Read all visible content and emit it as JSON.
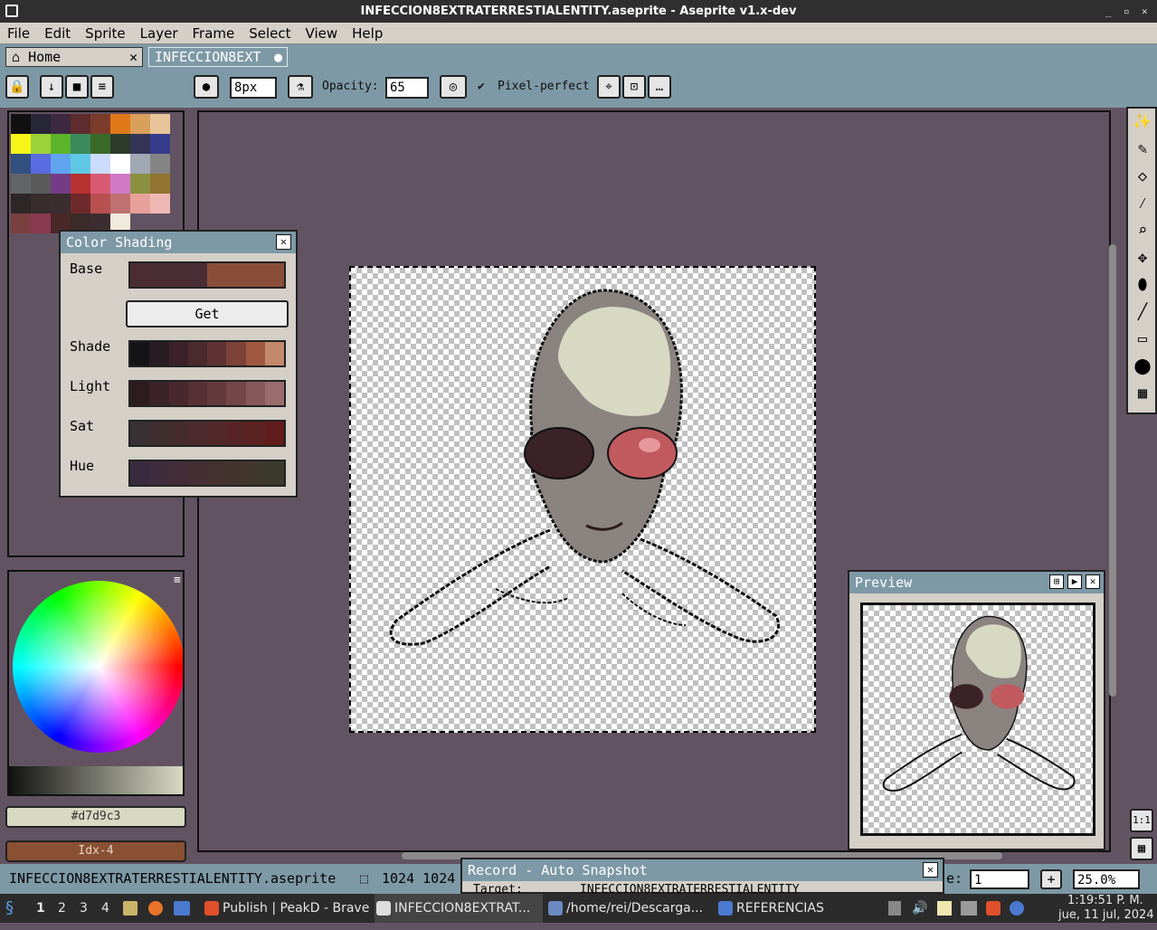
{
  "window": {
    "title": "INFECCION8EXTRATERRESTIALENTITY.aseprite - Aseprite v1.x-dev",
    "controls": [
      "_",
      "▫",
      "✕"
    ]
  },
  "menu": [
    "File",
    "Edit",
    "Sprite",
    "Layer",
    "Frame",
    "Select",
    "View",
    "Help"
  ],
  "tabs": {
    "home": "Home",
    "home_close": "✕",
    "doc": "INFECCION8EXT",
    "doc_dot": "●"
  },
  "toolbar": {
    "brush_size": "8px",
    "opacity_label": "Opacity:",
    "opacity_value": "65",
    "pixel_perfect_label": "Pixel-perfect",
    "pixel_perfect_check": "✔"
  },
  "palette": {
    "colors": [
      "#111111",
      "#262637",
      "#3e2841",
      "#5e2c2c",
      "#7b3c2c",
      "#e0781a",
      "#d8a05a",
      "#e8c49a",
      "#f5f51a",
      "#9cd23a",
      "#5cb42a",
      "#3a8a5c",
      "#3a6a2a",
      "#2c3a2c",
      "#343456",
      "#363c8c",
      "#325080",
      "#5a6ae0",
      "#60a4f0",
      "#60c8e4",
      "#ccdcfc",
      "#ffffff",
      "#a0a8b4",
      "#848484",
      "#626468",
      "#5a5a5a",
      "#743c86",
      "#b83232",
      "#d85a72",
      "#d07ac4",
      "#8a9040",
      "#907430",
      "#2e2626",
      "#382c2c",
      "#3a2e30",
      "#6e2a2a",
      "#b85050",
      "#c07070",
      "#e8a09a",
      "#f0b8b4",
      "#7a4040",
      "#8a3a52",
      "#4a2828",
      "#3a2a2a",
      "#3c2e30",
      "#f0eadc",
      "#625362",
      "#625362"
    ]
  },
  "shading": {
    "title": "Color Shading",
    "close": "✕",
    "base_label": "Base",
    "get_label": "Get",
    "shade_label": "Shade",
    "light_label": "Light",
    "sat_label": "Sat",
    "hue_label": "Hue",
    "base": [
      "#4a2c34",
      "#8a4e38"
    ],
    "shade": [
      "#141418",
      "#281c22",
      "#3a2228",
      "#4a2a2c",
      "#5e3232",
      "#7c4238",
      "#a0583e",
      "#c4886a"
    ],
    "light": [
      "#2c1c20",
      "#3a2228",
      "#48282e",
      "#563034",
      "#643a3c",
      "#744648",
      "#86585a",
      "#9a6c6c"
    ],
    "sat": [
      "#383032",
      "#3e2e30",
      "#442c2e",
      "#4a2a2c",
      "#502828",
      "#562424",
      "#5c2222",
      "#621c1c"
    ],
    "hue": [
      "#3a2a40",
      "#3e2c3c",
      "#422c38",
      "#442e34",
      "#44302e",
      "#42342c",
      "#40382c",
      "#3c3a2c"
    ]
  },
  "colors": {
    "fg_hex": "#d7d9c3",
    "fg": "#d7d9c3",
    "bg_label": "Idx-4",
    "bg": "#8a5034",
    "accent": "#7e99a6",
    "canvas": "#625362"
  },
  "preview": {
    "title": "Preview",
    "icons": [
      "⊞",
      "▶",
      "✕"
    ]
  },
  "status": {
    "filename": "INFECCION8EXTRATERRESTIALENTITY.aseprite",
    "size": "1024  1024",
    "frame_label": "e:",
    "frame_value": "1",
    "add": "+",
    "zoom": "25.0%"
  },
  "record": {
    "title": "Record - Auto Snapshot",
    "close": "✕",
    "target_label": "Target:",
    "target_value": "INFECCION8EXTRATERRESTIALENTITY"
  },
  "taskbar": {
    "workspaces": [
      "1",
      "2",
      "3",
      "4"
    ],
    "tasks": [
      "Publish | PeakD - Brave",
      "INFECCION8EXTRAT...",
      "/home/rei/Descarga...",
      "REFERENCIAS"
    ],
    "time": "1:19:51 P. M.",
    "date": "jue, 11 jul, 2024"
  }
}
